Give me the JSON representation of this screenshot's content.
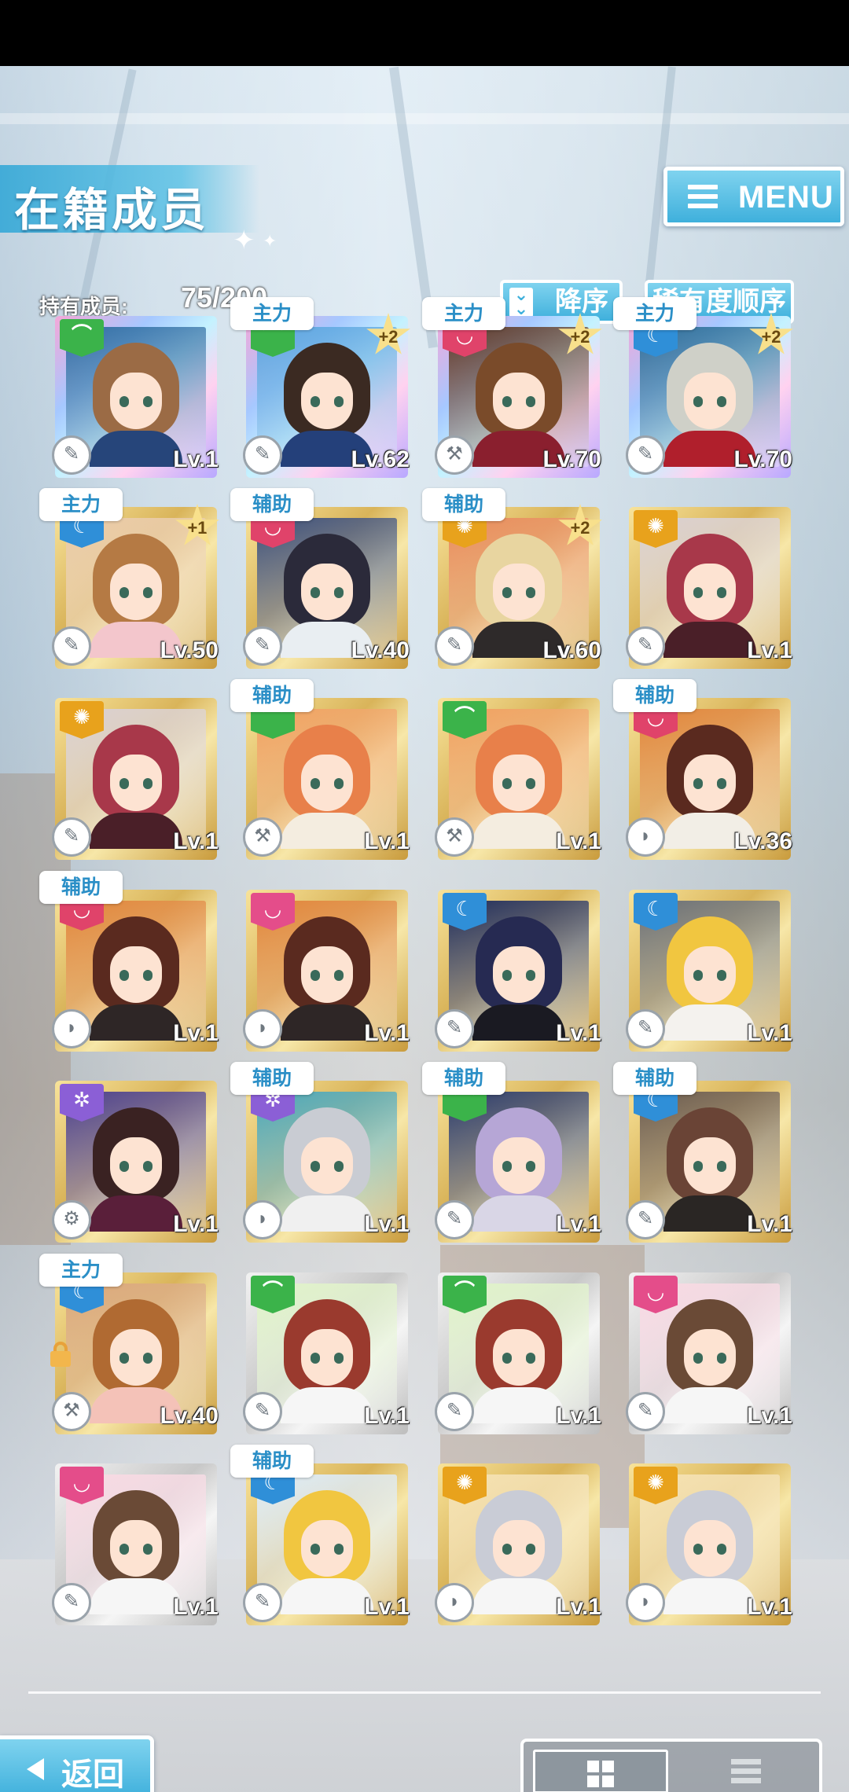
{
  "header": {
    "title": "在籍成员",
    "menu_label": "MENU"
  },
  "toolbar": {
    "owned_label": "持有成员:",
    "owned_count": "75/200",
    "sort_order_label": "降序",
    "sort_key_label": "稀有度顺序"
  },
  "footer": {
    "back_label": "返回",
    "view_modes": [
      "grid",
      "list"
    ],
    "active_view": "grid"
  },
  "attribute_colors": {
    "green": "#3bb34a",
    "red": "#e0436a",
    "blue": "#2f8fd8",
    "gold": "#e8a21c",
    "purple": "#8b5fd6",
    "pink": "#e44d8a"
  },
  "cards": [
    {
      "level": "Lv.1",
      "attr": "green",
      "role": "",
      "plus": "",
      "frame": "rainbow",
      "hair": "#9b6b45",
      "bg": "#2f6fa5",
      "cloth": "#26457a"
    },
    {
      "level": "Lv.62",
      "attr": "green",
      "role": "主力",
      "plus": "+2",
      "frame": "rainbow",
      "hair": "#3b2a22",
      "bg": "#5aa6e0",
      "cloth": "#24407a"
    },
    {
      "level": "Lv.70",
      "attr": "red",
      "role": "主力",
      "plus": "+2",
      "frame": "rainbow",
      "hair": "#7a4b2a",
      "bg": "#5d3b2a",
      "cloth": "#8a1f2e"
    },
    {
      "level": "Lv.70",
      "attr": "blue",
      "role": "主力",
      "plus": "+2",
      "frame": "rainbow",
      "hair": "#cfd0c8",
      "bg": "#2c6f9a",
      "cloth": "#b01f2c"
    },
    {
      "level": "Lv.50",
      "attr": "blue",
      "role": "主力",
      "plus": "+1",
      "frame": "gold",
      "hair": "#b57a44",
      "bg": "#e9c9a6",
      "cloth": "#f3c6cc"
    },
    {
      "level": "Lv.40",
      "attr": "red",
      "role": "辅助",
      "plus": "",
      "frame": "gold",
      "hair": "#2b2a3a",
      "bg": "#3b4e7a",
      "cloth": "#e9eef2"
    },
    {
      "level": "Lv.60",
      "attr": "gold",
      "role": "辅助",
      "plus": "+2",
      "frame": "gold",
      "hair": "#e8d5a0",
      "bg": "#e88a5a",
      "cloth": "#2e2a2a"
    },
    {
      "level": "Lv.1",
      "attr": "gold",
      "role": "",
      "plus": "",
      "frame": "gold",
      "hair": "#a8384a",
      "bg": "#d9cfd0",
      "cloth": "#4a1f28"
    },
    {
      "level": "Lv.1",
      "attr": "gold",
      "role": "",
      "plus": "",
      "frame": "gold",
      "hair": "#a8384a",
      "bg": "#d9cfd0",
      "cloth": "#4a1f28"
    },
    {
      "level": "Lv.1",
      "attr": "green",
      "role": "辅助",
      "plus": "",
      "frame": "gold",
      "hair": "#e8804a",
      "bg": "#f0a060",
      "cloth": "#f4ede0"
    },
    {
      "level": "Lv.1",
      "attr": "green",
      "role": "",
      "plus": "",
      "frame": "gold",
      "hair": "#e8804a",
      "bg": "#f0a060",
      "cloth": "#f4ede0"
    },
    {
      "level": "Lv.36",
      "attr": "red",
      "role": "辅助",
      "plus": "",
      "frame": "gold",
      "hair": "#5a2a1f",
      "bg": "#e0843a",
      "cloth": "#f2eee6"
    },
    {
      "level": "Lv.1",
      "attr": "red",
      "role": "辅助",
      "plus": "",
      "frame": "gold",
      "hair": "#5a2a1f",
      "bg": "#e0843a",
      "cloth": "#2e2626"
    },
    {
      "level": "Lv.1",
      "attr": "pink",
      "role": "",
      "plus": "",
      "frame": "gold",
      "hair": "#5a2a1f",
      "bg": "#e0843a",
      "cloth": "#2e2626"
    },
    {
      "level": "Lv.1",
      "attr": "blue",
      "role": "",
      "plus": "",
      "frame": "gold",
      "hair": "#262a52",
      "bg": "#1f2c5a",
      "cloth": "#1a1a22"
    },
    {
      "level": "Lv.1",
      "attr": "blue",
      "role": "",
      "plus": "",
      "frame": "gold",
      "hair": "#f1c640",
      "bg": "#6a6f76",
      "cloth": "#f4f2ee"
    },
    {
      "level": "Lv.1",
      "attr": "purple",
      "role": "",
      "plus": "",
      "frame": "gold",
      "hair": "#3a2222",
      "bg": "#4b3f8c",
      "cloth": "#5a1f3a"
    },
    {
      "level": "Lv.1",
      "attr": "purple",
      "role": "辅助",
      "plus": "",
      "frame": "gold",
      "hair": "#c9ccd3",
      "bg": "#4aa6b8",
      "cloth": "#f0f0f0"
    },
    {
      "level": "Lv.1",
      "attr": "green",
      "role": "辅助",
      "plus": "",
      "frame": "gold",
      "hair": "#b6a6d6",
      "bg": "#2a3a6a",
      "cloth": "#d9d6e6"
    },
    {
      "level": "Lv.1",
      "attr": "blue",
      "role": "辅助",
      "plus": "",
      "frame": "gold",
      "hair": "#6a4436",
      "bg": "#6a5a4e",
      "cloth": "#2a2624"
    },
    {
      "level": "Lv.40",
      "attr": "blue",
      "role": "主力",
      "plus": "",
      "frame": "gold",
      "hair": "#b06a32",
      "bg": "#d9a67a",
      "cloth": "#f4c2b8",
      "locked": true
    },
    {
      "level": "Lv.1",
      "attr": "green",
      "role": "",
      "plus": "",
      "frame": "silver",
      "hair": "#9a3a2e",
      "bg": "#dff2c8",
      "cloth": "#f6f6f6"
    },
    {
      "level": "Lv.1",
      "attr": "green",
      "role": "",
      "plus": "",
      "frame": "silver",
      "hair": "#9a3a2e",
      "bg": "#dff2c8",
      "cloth": "#f6f6f6"
    },
    {
      "level": "Lv.1",
      "attr": "pink",
      "role": "",
      "plus": "",
      "frame": "silver",
      "hair": "#6a4a36",
      "bg": "#f7d8e2",
      "cloth": "#f6f6f6"
    },
    {
      "level": "Lv.1",
      "attr": "pink",
      "role": "",
      "plus": "",
      "frame": "silver",
      "hair": "#6a4a36",
      "bg": "#f7d8e2",
      "cloth": "#f6f6f6"
    },
    {
      "level": "Lv.1",
      "attr": "blue",
      "role": "辅助",
      "plus": "",
      "frame": "gold",
      "hair": "#f1c640",
      "bg": "#dceaf6",
      "cloth": "#f6f6f6"
    },
    {
      "level": "Lv.1",
      "attr": "gold",
      "role": "",
      "plus": "",
      "frame": "gold",
      "hair": "#c9ccd6",
      "bg": "#f4e0b0",
      "cloth": "#f6f6f6"
    },
    {
      "level": "Lv.1",
      "attr": "gold",
      "role": "",
      "plus": "",
      "frame": "gold",
      "hair": "#c9ccd6",
      "bg": "#f4e0b0",
      "cloth": "#f6f6f6"
    }
  ]
}
